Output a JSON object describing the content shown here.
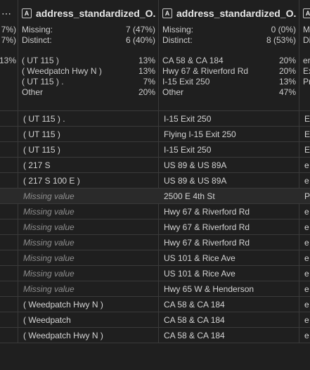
{
  "col0": {
    "header_dots": "⋯",
    "stats": [
      "7%)",
      "7%)"
    ],
    "freq": [
      "13%"
    ]
  },
  "col1": {
    "title": "address_standardized_O...",
    "missing_label": "Missing:",
    "missing_value": "7 (47%)",
    "distinct_label": "Distinct:",
    "distinct_value": "6 (40%)",
    "freq": [
      {
        "label": "( UT 115 )",
        "pct": "13%"
      },
      {
        "label": "( Weedpatch Hwy N )",
        "pct": "13%"
      },
      {
        "label": "( UT 115 ) .",
        "pct": "7%"
      },
      {
        "label": "Other",
        "pct": "20%"
      }
    ]
  },
  "col2": {
    "title": "address_standardized_O...",
    "missing_label": "Missing:",
    "missing_value": "0 (0%)",
    "distinct_label": "Distinct:",
    "distinct_value": "8 (53%)",
    "freq": [
      {
        "label": "CA 58 & CA 184",
        "pct": "20%"
      },
      {
        "label": "Hwy 67 & Riverford Rd",
        "pct": "20%"
      },
      {
        "label": "I-15 Exit 250",
        "pct": "13%"
      },
      {
        "label": "Other",
        "pct": "47%"
      }
    ]
  },
  "col3": {
    "title": "A",
    "stats": [
      "M",
      "Di"
    ],
    "freq": [
      "er",
      "Ex",
      "Pr"
    ]
  },
  "rows": [
    {
      "c1": "( UT 115 ) .",
      "c1_missing": false,
      "c2": "I-15 Exit 250",
      "c3": "E"
    },
    {
      "c1": "( UT 115 )",
      "c1_missing": false,
      "c2": "Flying I-15 Exit 250",
      "c3": "E"
    },
    {
      "c1": "( UT 115 )",
      "c1_missing": false,
      "c2": "I-15 Exit 250",
      "c3": "E"
    },
    {
      "c1": "( 217 S",
      "c1_missing": false,
      "c2": "US 89 & US 89A",
      "c3": "e"
    },
    {
      "c1": "( 217 S 100 E )",
      "c1_missing": false,
      "c2": "US 89 & US 89A",
      "c3": "e"
    },
    {
      "c1": "Missing value",
      "c1_missing": true,
      "c2": "2500 E 4th St",
      "c3": "P"
    },
    {
      "c1": "Missing value",
      "c1_missing": true,
      "c2": "Hwy 67 & Riverford Rd",
      "c3": "e"
    },
    {
      "c1": "Missing value",
      "c1_missing": true,
      "c2": "Hwy 67 & Riverford Rd",
      "c3": "e"
    },
    {
      "c1": "Missing value",
      "c1_missing": true,
      "c2": "Hwy 67 & Riverford Rd",
      "c3": "e"
    },
    {
      "c1": "Missing value",
      "c1_missing": true,
      "c2": "US 101 & Rice Ave",
      "c3": "e"
    },
    {
      "c1": "Missing value",
      "c1_missing": true,
      "c2": "US 101 & Rice Ave",
      "c3": "e"
    },
    {
      "c1": "Missing value",
      "c1_missing": true,
      "c2": "Hwy 65 W & Henderson",
      "c3": "e"
    },
    {
      "c1": "( Weedpatch Hwy N )",
      "c1_missing": false,
      "c2": "CA 58 & CA 184",
      "c3": "e"
    },
    {
      "c1": "( Weedpatch",
      "c1_missing": false,
      "c2": "CA 58 & CA 184",
      "c3": "e"
    },
    {
      "c1": "( Weedpatch Hwy N )",
      "c1_missing": false,
      "c2": "CA 58 & CA 184",
      "c3": "e"
    }
  ]
}
